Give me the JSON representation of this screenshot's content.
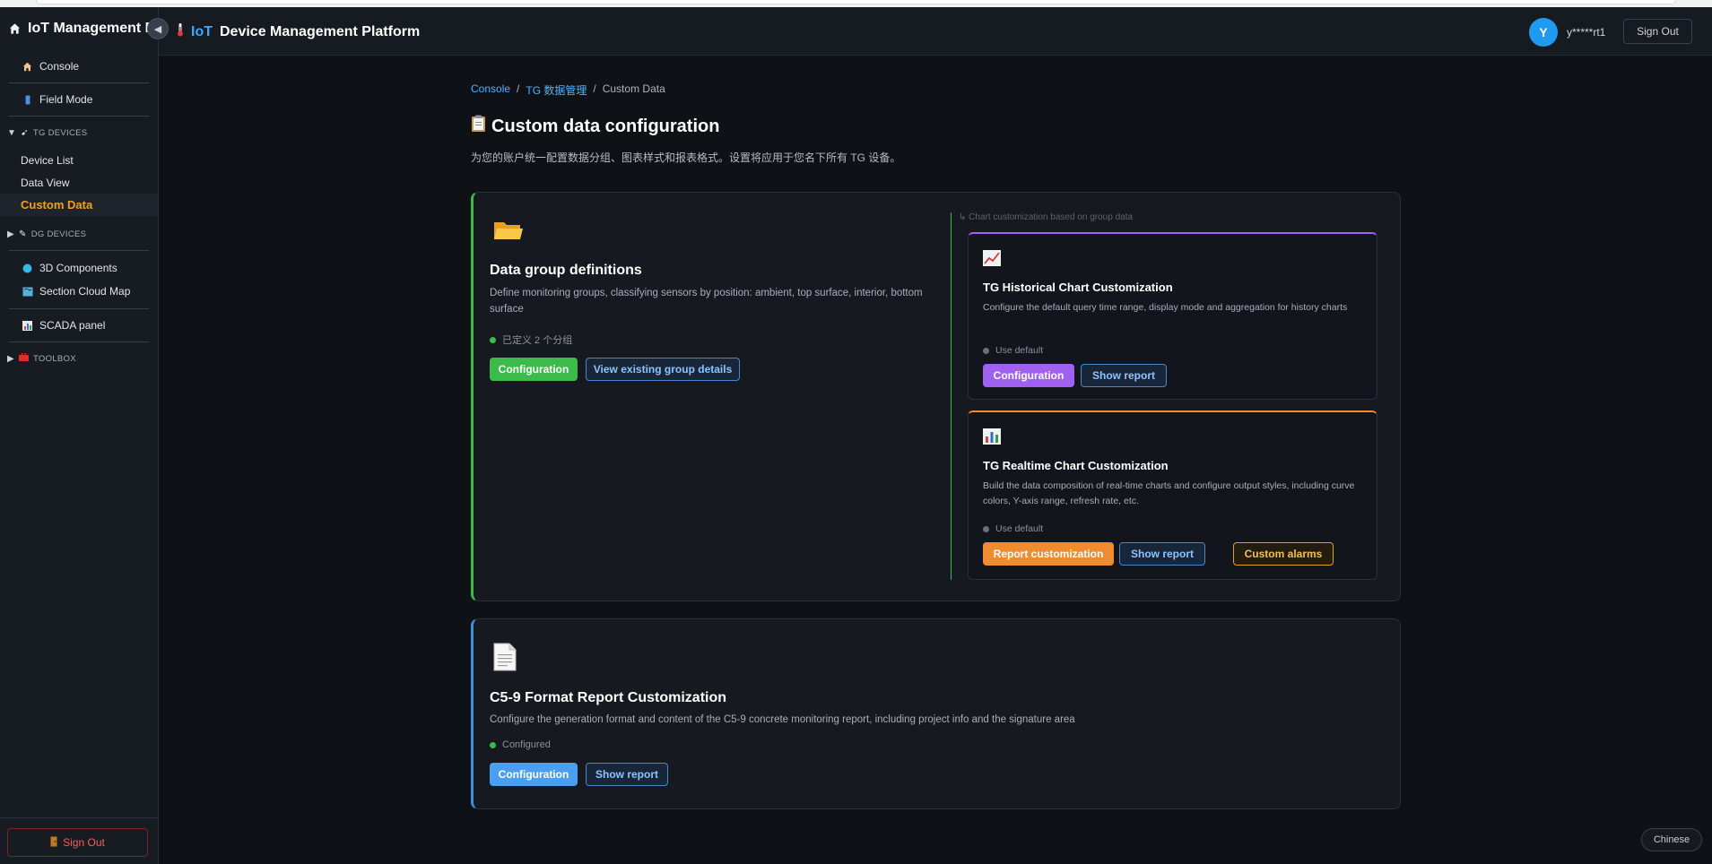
{
  "sidebar": {
    "title": "IoT Management Platform",
    "items": {
      "console": "Console",
      "field_mode": "Field Mode",
      "tg_devices": "TG DEVICES",
      "device_list": "Device List",
      "data_view": "Data View",
      "custom_data": "Custom Data",
      "dg_devices": "DG DEVICES",
      "components_3d": "3D Components",
      "section_cloud_map": "Section Cloud Map",
      "scada_panel": "SCADA panel",
      "toolbox": "TOOLBOX"
    },
    "sign_out": "Sign Out"
  },
  "topbar": {
    "title_prefix": "IoT",
    "title": "Device Management Platform",
    "avatar_initial": "Y",
    "username": "y*****rt1",
    "sign_out": "Sign Out"
  },
  "breadcrumb": {
    "console": "Console",
    "tg": "TG 数据管理",
    "current": "Custom Data",
    "sep": "/"
  },
  "page": {
    "title": "Custom data configuration",
    "description": "为您的账户统一配置数据分组、图表样式和报表格式。设置将应用于您名下所有 TG 设备。"
  },
  "groups_card": {
    "title": "Data group definitions",
    "description": "Define monitoring groups, classifying sensors by position: ambient, top surface, interior, bottom surface",
    "status": "已定义 2 个分组",
    "btn_config": "Configuration",
    "btn_view": "View existing group details",
    "note": "↳ Chart customization based on group data"
  },
  "history_card": {
    "title": "TG Historical Chart Customization",
    "description": "Configure the default query time range, display mode and aggregation for history charts",
    "status": "Use default",
    "btn_config": "Configuration",
    "btn_report": "Show report"
  },
  "realtime_card": {
    "title": "TG Realtime Chart Customization",
    "description": "Build the data composition of real-time charts and configure output styles, including curve colors, Y-axis range, refresh rate, etc.",
    "status": "Use default",
    "btn_custom": "Report customization",
    "btn_report": "Show report",
    "btn_alarms": "Custom alarms"
  },
  "c59_card": {
    "title": "C5-9 Format Report Customization",
    "description": "Configure the generation format and content of the C5-9 concrete monitoring report, including project info and the signature area",
    "status": "Configured",
    "btn_config": "Configuration",
    "btn_report": "Show report"
  },
  "language": "Chinese",
  "icons": {
    "home": "home-icon",
    "thermometer": "thermometer-icon",
    "folder": "folder-icon",
    "chart_up": "chart-increasing-icon",
    "bar_chart": "bar-chart-icon",
    "document": "document-icon",
    "clipboard": "clipboard-icon"
  },
  "colors": {
    "accent_green": "#3dbb4a",
    "accent_blue": "#4a9ff0",
    "accent_purple": "#a060f0",
    "accent_orange": "#f08c30",
    "active_nav": "#f0a020"
  }
}
